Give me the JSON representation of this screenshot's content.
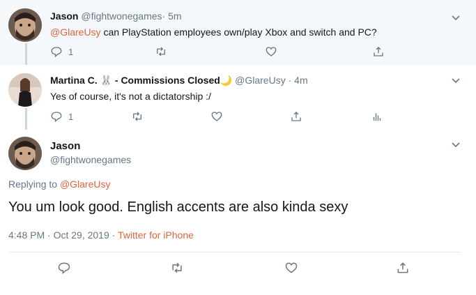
{
  "colors": {
    "accent": "#e0633d",
    "muted": "#657786",
    "text": "#14171a",
    "highlight_bg": "#f5f8fa"
  },
  "tweets": [
    {
      "name": "Jason",
      "handle": "@fightwonegames",
      "separator": "·",
      "time": "5m",
      "mention": "@GlareUsy",
      "text": " can PlayStation employees own/play Xbox and switch and PC?",
      "reply_count": "1"
    },
    {
      "name": "Martina C. 🐰 - Commissions Closed🌙",
      "handle": "@GlareUsy",
      "separator": "·",
      "time": "4m",
      "text": "Yes of course, it's not a dictatorship :/",
      "reply_count": "1"
    }
  ],
  "main_tweet": {
    "name": "Jason",
    "handle": "@fightwonegames",
    "replying_prefix": "Replying to ",
    "replying_to": "@GlareUsy",
    "text": "You um look good. English accents are also kinda sexy",
    "timestamp": "4:48 PM · Oct 29, 2019",
    "source_sep": " · ",
    "source": "Twitter for iPhone"
  },
  "icons": [
    "reply-icon",
    "retweet-icon",
    "like-icon",
    "share-icon",
    "analytics-icon",
    "caret-down-icon"
  ]
}
